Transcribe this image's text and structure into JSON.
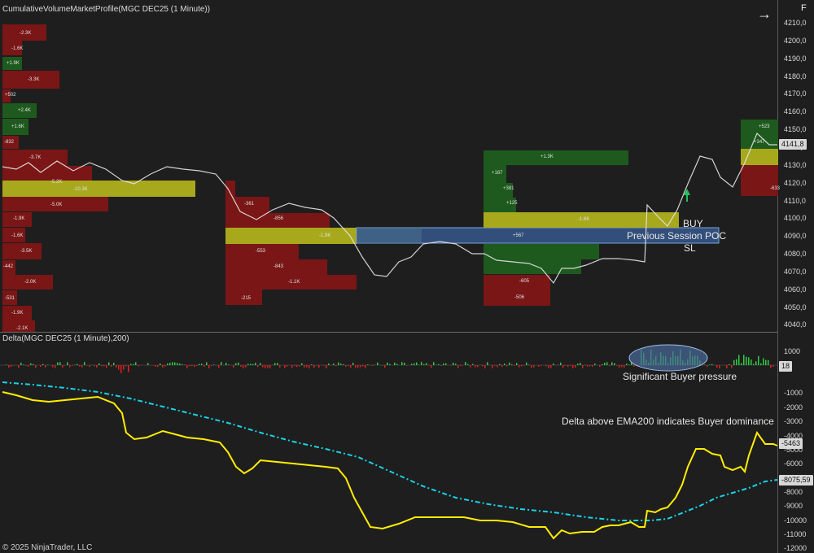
{
  "top_panel": {
    "title": "CumulativeVolumeMarketProfile(MGC DEC25 (1 Minute))",
    "price_axis": [
      "4210,0",
      "4200,0",
      "4190,0",
      "4180,0",
      "4170,0",
      "4160,0",
      "4150,0",
      "4140,0",
      "4130,0",
      "4120,0",
      "4110,0",
      "4100,0",
      "4090,0",
      "4080,0",
      "4070,0",
      "4060,0",
      "4050,0",
      "4040,0"
    ],
    "last_price": "4141,8",
    "annotations": {
      "buy": "BUY",
      "poc": "Previous Session POC",
      "sl": "SL"
    },
    "profile_labels": [
      "-2.3K",
      "-1.6K",
      "+1.9K",
      "-3.3K",
      "+502",
      "+2.4K",
      "+1.6K",
      "-832",
      "-3.7K",
      "-5.2K",
      "-10.3K",
      "-5.0K",
      "-1.9K",
      "-1.6K",
      "-3.5K",
      "-442",
      "-2.0K",
      "-531",
      "-1.9K",
      "-2.1K",
      "-361",
      "-856",
      "-1.9K",
      "-553",
      "-843",
      "-1.1K",
      "-215",
      "+1.3K",
      "+167",
      "+381",
      "+125",
      "-1.6K",
      "+567",
      "-605",
      "-506",
      "+523",
      "+347",
      "-633"
    ]
  },
  "bottom_panel": {
    "title": "Delta(MGC DEC25 (1 Minute),200)",
    "axis": [
      "1000",
      "-1000",
      "-2000",
      "-3000",
      "-4000",
      "-5000",
      "-6000",
      "-7000",
      "-8000",
      "-9000",
      "-10000",
      "-11000",
      "-12000"
    ],
    "delta_flag": "18",
    "cum_delta_flag": "-5463",
    "ema_flag": "-8075,59",
    "annotations": {
      "pressure": "Significant Buyer pressure",
      "dominance": "Delta above EMA200 indicates Buyer dominance"
    }
  },
  "footer": {
    "copyright": "© 2025 NinjaTrader, LLC"
  },
  "toolbar": {
    "arrow_icon": "arrow-right-icon",
    "f_label": "F"
  },
  "colors": {
    "background": "#1e1e1e",
    "buy_zone": "#1e5a1e",
    "sell_zone": "#7a1616",
    "poc_band": "#a8a81c",
    "delta_line": "#ffee00",
    "ema_line": "#19d3e6",
    "poc_highlight": "#3a5f9a"
  }
}
